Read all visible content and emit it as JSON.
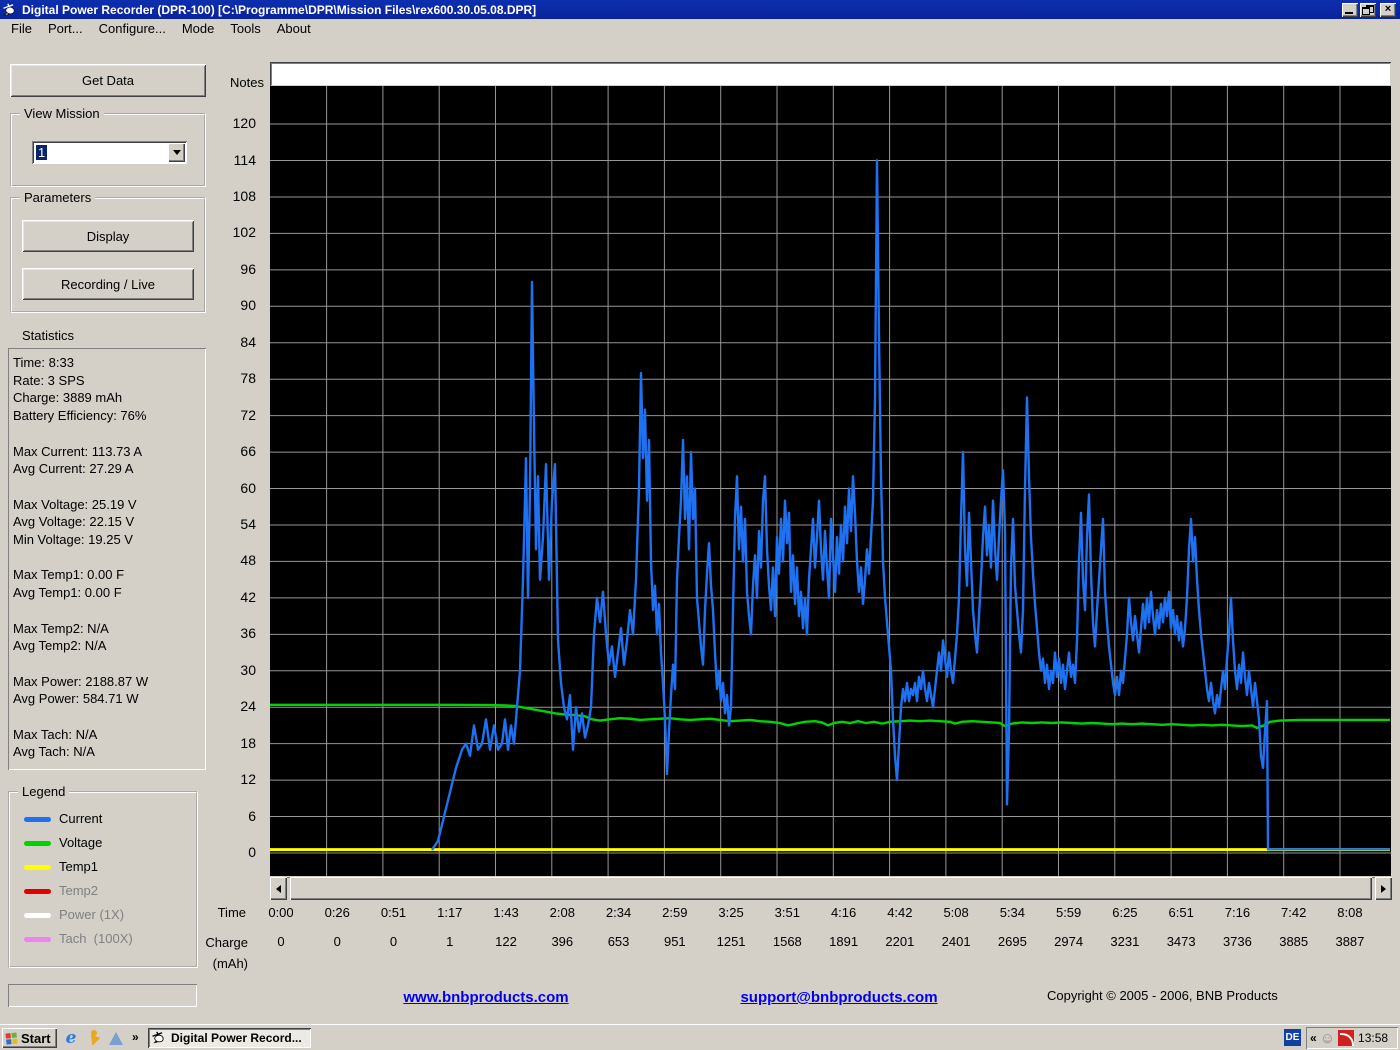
{
  "window": {
    "title": "Digital Power Recorder (DPR-100) [C:\\Programme\\DPR\\Mission Files\\rex600.30.05.08.DPR]",
    "icon": "helicopter-icon"
  },
  "menu": {
    "items": [
      "File",
      "Port...",
      "Configure...",
      "Mode",
      "Tools",
      "About"
    ]
  },
  "sidebar": {
    "get_data_label": "Get Data",
    "view_mission": {
      "label": "View Mission",
      "value": "1"
    },
    "parameters": {
      "label": "Parameters",
      "display_label": "Display",
      "recording_label": "Recording / Live"
    },
    "statistics": {
      "label": "Statistics",
      "lines": [
        "Time: 8:33",
        "Rate: 3 SPS",
        "Charge: 3889 mAh",
        "Battery Efficiency: 76%",
        "",
        "Max Current: 113.73 A",
        "Avg Current: 27.29 A",
        "",
        "Max Voltage: 25.19 V",
        "Avg Voltage: 22.15 V",
        "Min Voltage: 19.25 V",
        "",
        "Max Temp1: 0.00 F",
        "Avg Temp1: 0.00 F",
        "",
        "Max Temp2: N/A",
        "Avg Temp2: N/A",
        "",
        "Max Power: 2188.87 W",
        "Avg Power: 584.71 W",
        "",
        "Max Tach: N/A",
        "Avg Tach: N/A"
      ]
    },
    "legend": {
      "label": "Legend",
      "items": [
        {
          "name": "Current",
          "color": "#1e71f0",
          "enabled": true
        },
        {
          "name": "Voltage",
          "color": "#00d400",
          "enabled": true
        },
        {
          "name": "Temp1",
          "color": "#ffff00",
          "enabled": true
        },
        {
          "name": "Temp2",
          "color": "#e00000",
          "enabled": false
        },
        {
          "name": "Power (1X)",
          "color": "#ffffff",
          "enabled": false
        },
        {
          "name": "Tach  (100X)",
          "color": "#ee82ee",
          "enabled": false
        }
      ]
    }
  },
  "chart_data": {
    "type": "line",
    "notes_label": "Notes",
    "plot_bg": "#000000",
    "grid_color": "#969696",
    "y_axis": {
      "ticks": [
        120,
        114,
        108,
        102,
        96,
        90,
        84,
        78,
        72,
        66,
        60,
        54,
        48,
        42,
        36,
        30,
        24,
        18,
        12,
        6,
        0
      ],
      "range": [
        -3.8,
        126.3
      ]
    },
    "x_axis": {
      "label": "Time",
      "ticks": [
        "0:00",
        "0:26",
        "0:51",
        "1:17",
        "1:43",
        "2:08",
        "2:34",
        "2:59",
        "3:25",
        "3:51",
        "4:16",
        "4:42",
        "5:08",
        "5:34",
        "5:59",
        "6:25",
        "6:51",
        "7:16",
        "7:42",
        "8:08"
      ]
    },
    "x2_axis": {
      "label": "Charge",
      "sublabel": "(mAh)",
      "values": [
        "0",
        "0",
        "0",
        "1",
        "122",
        "396",
        "653",
        "951",
        "1251",
        "1568",
        "1891",
        "2201",
        "2401",
        "2695",
        "2974",
        "3231",
        "3473",
        "3736",
        "3885",
        "3887"
      ]
    },
    "series": [
      {
        "name": "Temp1",
        "unit": "F",
        "color": "#ffff00",
        "width": 3,
        "points": [
          270,
          0.55,
          1390,
          0.55
        ]
      },
      {
        "name": "Voltage",
        "unit": "V",
        "color": "#00d400",
        "width": 2.4,
        "points": [
          270,
          24.4,
          340,
          24.4,
          400,
          24.4,
          450,
          24.4,
          490,
          24.35,
          505,
          24.3,
          515,
          24.2,
          525,
          23.9,
          535,
          23.6,
          545,
          23.3,
          555,
          23,
          565,
          22.8,
          575,
          22.7,
          585,
          22.5,
          592,
          22,
          600,
          21.8,
          610,
          22,
          620,
          22.2,
          630,
          22.1,
          640,
          21.9,
          650,
          22,
          660,
          22.1,
          670,
          22.2,
          680,
          22,
          690,
          21.9,
          700,
          22,
          710,
          22.1,
          720,
          21.9,
          730,
          21.7,
          740,
          21.8,
          750,
          21.9,
          760,
          21.7,
          770,
          21.6,
          780,
          21.4,
          788,
          21,
          796,
          21.3,
          805,
          21.6,
          815,
          21.7,
          822,
          21.5,
          828,
          21,
          834,
          21.4,
          842,
          21.6,
          850,
          21.4,
          858,
          21.7,
          866,
          21.4,
          874,
          21.6,
          882,
          21.3,
          890,
          21.6,
          900,
          21.7,
          910,
          21.8,
          920,
          21.7,
          930,
          21.8,
          940,
          21.7,
          950,
          21.6,
          955,
          21.3,
          962,
          21.6,
          972,
          21.7,
          982,
          21.6,
          992,
          21.5,
          1000,
          21.4,
          1005,
          20.9,
          1012,
          21.3,
          1022,
          21.5,
          1032,
          21.4,
          1042,
          21.5,
          1052,
          21.4,
          1062,
          21.5,
          1072,
          21.4,
          1082,
          21.3,
          1092,
          21.4,
          1102,
          21.3,
          1112,
          21.2,
          1122,
          21.3,
          1132,
          21.2,
          1142,
          21.3,
          1152,
          21.2,
          1162,
          21.1,
          1172,
          21.2,
          1182,
          21.1,
          1192,
          21,
          1202,
          21.1,
          1212,
          21,
          1222,
          21.1,
          1232,
          21,
          1242,
          20.9,
          1252,
          21,
          1257,
          20.6,
          1262,
          20.9,
          1266,
          21.1,
          1270,
          21.6,
          1280,
          21.8,
          1300,
          21.9,
          1330,
          21.9,
          1390,
          21.9
        ]
      },
      {
        "name": "Current",
        "unit": "A",
        "color": "#1e71f0",
        "width": 2.4,
        "points": [
          432,
          0.5,
          438,
          2,
          444,
          6,
          450,
          10,
          456,
          14,
          462,
          17,
          466,
          18,
          470,
          16,
          474,
          21,
          478,
          17,
          482,
          18,
          486,
          22,
          490,
          17,
          494,
          21,
          498,
          17,
          502,
          18,
          505,
          22,
          508,
          17,
          511,
          21,
          514,
          18,
          517,
          24,
          520,
          30,
          523,
          45,
          526,
          65,
          528,
          42,
          530,
          60,
          532,
          94,
          534,
          70,
          536,
          50,
          538,
          62,
          540,
          45,
          543,
          52,
          546,
          64,
          549,
          45,
          552,
          58,
          555,
          64,
          558,
          35,
          561,
          28,
          564,
          24,
          567,
          22,
          570,
          26,
          573,
          17,
          576,
          24,
          579,
          20,
          582,
          23,
          585,
          19,
          588,
          21,
          591,
          24,
          594,
          36,
          597,
          42,
          600,
          38,
          603,
          43,
          606,
          36,
          609,
          31,
          612,
          34,
          615,
          29,
          618,
          33,
          621,
          37,
          624,
          31,
          627,
          35,
          630,
          40,
          633,
          36,
          636,
          45,
          639,
          60,
          641,
          79,
          643,
          65,
          645,
          73,
          647,
          58,
          649,
          68,
          651,
          48,
          653,
          40,
          655,
          44,
          657,
          36,
          659,
          41,
          661,
          33,
          663,
          28,
          665,
          22,
          667,
          13,
          669,
          20,
          671,
          26,
          673,
          31,
          675,
          27,
          677,
          45,
          679,
          52,
          681,
          58,
          683,
          68,
          685,
          55,
          687,
          62,
          689,
          50,
          691,
          66,
          693,
          55,
          695,
          60,
          697,
          42,
          699,
          38,
          701,
          34,
          703,
          31,
          705,
          40,
          707,
          46,
          709,
          51,
          711,
          44,
          713,
          40,
          715,
          33,
          717,
          27,
          719,
          30,
          721,
          25,
          723,
          28,
          725,
          23,
          727,
          26,
          729,
          21,
          731,
          24,
          733,
          40,
          735,
          55,
          737,
          62,
          739,
          50,
          741,
          57,
          743,
          48,
          745,
          55,
          747,
          43,
          749,
          39,
          751,
          36,
          753,
          44,
          755,
          49,
          757,
          42,
          759,
          53,
          761,
          47,
          763,
          58,
          765,
          62,
          767,
          50,
          769,
          44,
          771,
          40,
          773,
          47,
          775,
          39,
          777,
          52,
          779,
          46,
          781,
          55,
          783,
          48,
          785,
          58,
          787,
          51,
          789,
          56,
          791,
          43,
          793,
          49,
          795,
          41,
          797,
          47,
          799,
          39,
          801,
          43,
          803,
          37,
          805,
          42,
          807,
          36,
          809,
          45,
          811,
          50,
          813,
          55,
          815,
          47,
          817,
          52,
          819,
          58,
          821,
          50,
          823,
          45,
          825,
          53,
          827,
          47,
          829,
          42,
          831,
          55,
          833,
          49,
          835,
          43,
          837,
          52,
          839,
          46,
          841,
          54,
          843,
          48,
          845,
          57,
          847,
          51,
          849,
          60,
          851,
          53,
          853,
          62,
          855,
          56,
          857,
          48,
          859,
          43,
          861,
          47,
          863,
          41,
          865,
          45,
          867,
          50,
          869,
          46,
          871,
          52,
          873,
          58,
          875,
          75,
          877,
          114,
          879,
          85,
          881,
          62,
          883,
          48,
          885,
          42,
          887,
          38,
          889,
          34,
          891,
          30,
          893,
          22,
          895,
          16,
          897,
          12,
          899,
          18,
          901,
          24,
          903,
          27,
          905,
          25,
          907,
          28,
          909,
          25,
          911,
          27,
          913,
          26,
          915,
          28,
          917,
          25,
          919,
          29,
          921,
          27,
          923,
          30,
          925,
          27,
          927,
          25,
          929,
          28,
          931,
          26,
          933,
          24,
          935,
          27,
          937,
          30,
          939,
          33,
          941,
          30,
          943,
          35,
          945,
          32,
          947,
          29,
          949,
          33,
          951,
          30,
          953,
          28,
          955,
          32,
          957,
          36,
          959,
          42,
          961,
          55,
          963,
          66,
          965,
          50,
          967,
          44,
          969,
          56,
          971,
          48,
          973,
          40,
          975,
          36,
          977,
          33,
          979,
          39,
          981,
          45,
          983,
          52,
          985,
          57,
          987,
          49,
          989,
          54,
          991,
          47,
          993,
          58,
          995,
          50,
          997,
          45,
          999,
          52,
          1001,
          58,
          1003,
          63,
          1005,
          53,
          1007,
          8,
          1009,
          20,
          1011,
          47,
          1013,
          55,
          1015,
          44,
          1017,
          40,
          1019,
          36,
          1021,
          33,
          1023,
          40,
          1025,
          60,
          1027,
          75,
          1029,
          62,
          1031,
          52,
          1033,
          46,
          1035,
          41,
          1037,
          37,
          1039,
          33,
          1041,
          30,
          1043,
          32,
          1045,
          28,
          1047,
          31,
          1049,
          27,
          1051,
          30,
          1053,
          28,
          1055,
          33,
          1057,
          29,
          1059,
          32,
          1061,
          28,
          1063,
          31,
          1065,
          27,
          1067,
          30,
          1069,
          33,
          1071,
          29,
          1073,
          31,
          1075,
          28,
          1077,
          35,
          1079,
          48,
          1081,
          56,
          1083,
          45,
          1085,
          40,
          1087,
          52,
          1089,
          59,
          1091,
          46,
          1093,
          38,
          1095,
          34,
          1097,
          40,
          1099,
          45,
          1101,
          50,
          1103,
          55,
          1105,
          43,
          1107,
          38,
          1109,
          34,
          1111,
          31,
          1113,
          28,
          1115,
          26,
          1117,
          29,
          1119,
          26,
          1121,
          30,
          1123,
          28,
          1125,
          32,
          1127,
          36,
          1129,
          42,
          1131,
          38,
          1133,
          35,
          1135,
          39,
          1137,
          36,
          1139,
          33,
          1141,
          37,
          1143,
          41,
          1145,
          37,
          1147,
          42,
          1149,
          38,
          1151,
          43,
          1153,
          39,
          1155,
          36,
          1157,
          40,
          1159,
          37,
          1161,
          41,
          1163,
          38,
          1165,
          42,
          1167,
          39,
          1169,
          43,
          1171,
          37,
          1173,
          40,
          1175,
          36,
          1177,
          39,
          1179,
          35,
          1181,
          38,
          1183,
          34,
          1185,
          37,
          1187,
          42,
          1189,
          50,
          1191,
          55,
          1193,
          48,
          1195,
          52,
          1197,
          45,
          1199,
          40,
          1201,
          36,
          1203,
          33,
          1205,
          30,
          1207,
          27,
          1209,
          25,
          1211,
          28,
          1213,
          25,
          1215,
          23,
          1217,
          26,
          1219,
          24,
          1221,
          27,
          1223,
          30,
          1225,
          27,
          1227,
          32,
          1229,
          36,
          1231,
          42,
          1233,
          35,
          1235,
          30,
          1237,
          27,
          1239,
          31,
          1241,
          28,
          1243,
          33,
          1245,
          29,
          1247,
          26,
          1249,
          30,
          1251,
          27,
          1253,
          24,
          1255,
          28,
          1257,
          25,
          1259,
          22,
          1261,
          16,
          1263,
          14,
          1265,
          20,
          1267,
          25,
          1268,
          0.6,
          1390,
          0.6
        ]
      }
    ]
  },
  "footer": {
    "link1": "www.bnbproducts.com",
    "link2": "support@bnbproducts.com",
    "copyright": "Copyright © 2005 - 2006, BNB Products"
  },
  "taskbar": {
    "start_label": "Start",
    "more_chevron": "»",
    "task_label": "Digital Power Record...",
    "tray": {
      "chevron": "«",
      "language": "DE",
      "clock": "13:58"
    }
  }
}
